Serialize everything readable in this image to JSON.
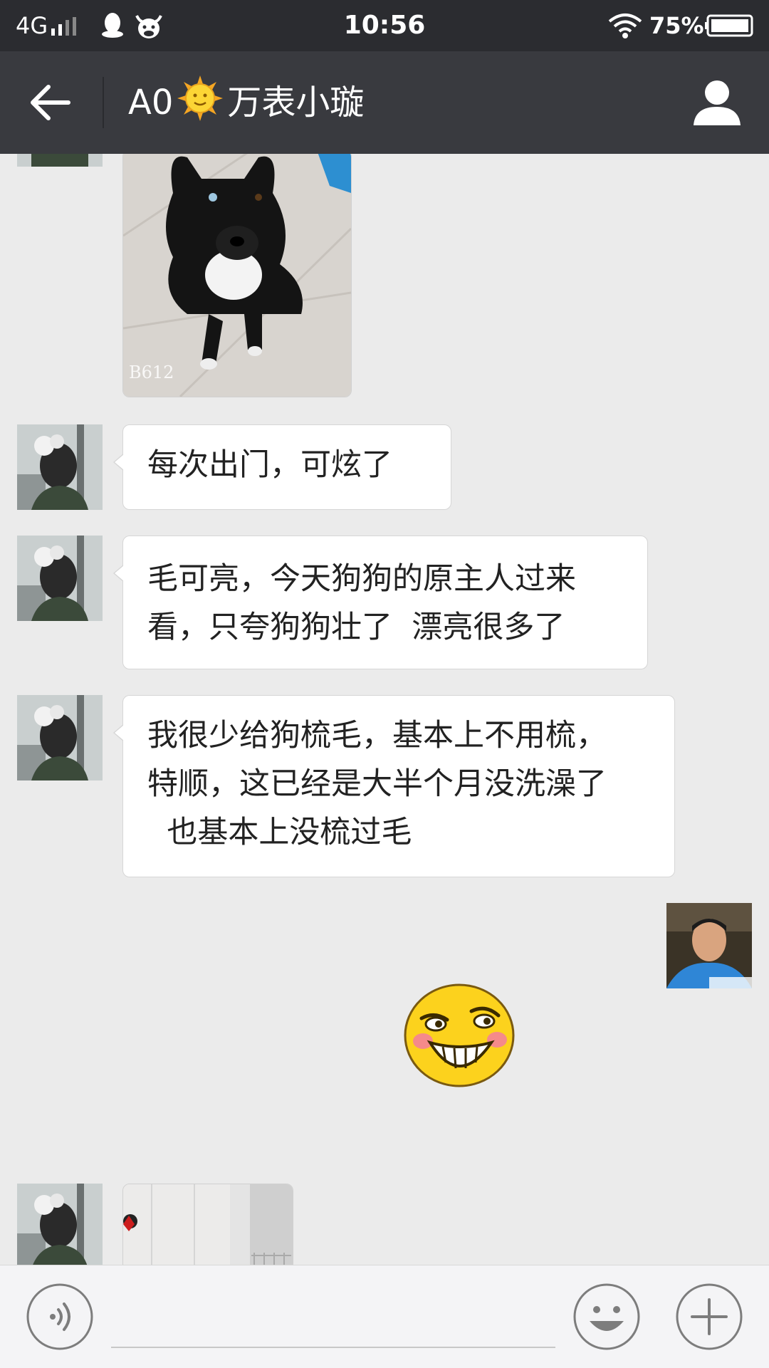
{
  "status_bar": {
    "network": "4G",
    "time": "10:56",
    "battery_percent": "75%"
  },
  "header": {
    "title_prefix": "A0",
    "title_suffix": "万表小璇",
    "back_icon": "arrow-left-icon",
    "profile_icon": "person-icon"
  },
  "messages": [
    {
      "side": "left",
      "type": "image",
      "content": "dog-photo",
      "watermark": "B612"
    },
    {
      "side": "left",
      "type": "text",
      "text": "每次出门，可炫了"
    },
    {
      "side": "left",
      "type": "text",
      "text": "毛可亮，今天狗狗的原主人过来\n看，只夸狗狗壮了  漂亮很多了"
    },
    {
      "side": "left",
      "type": "text",
      "text": "我很少给狗梳毛，基本上不用梳，\n特顺，这已经是大半个月没洗澡了\n  也基本上没梳过毛"
    },
    {
      "side": "right",
      "type": "sticker",
      "content": "grinning-sticker"
    },
    {
      "side": "left",
      "type": "image",
      "content": "room-photo"
    }
  ],
  "input_bar": {
    "voice_icon": "voice-icon",
    "emoji_icon": "emoji-icon",
    "plus_icon": "plus-icon"
  },
  "colors": {
    "status_bar_bg": "#2b2c30",
    "header_bg": "#393a3f",
    "chat_bg": "#ebebeb",
    "bubble_bg": "#ffffff"
  }
}
